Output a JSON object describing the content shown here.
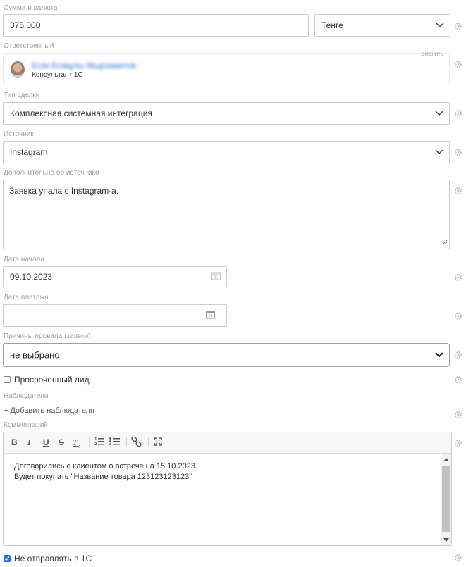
{
  "amount": {
    "label": "Сумма и валюта",
    "value": "375 000",
    "currency": "Тенге"
  },
  "responsible": {
    "label": "Ответственный",
    "name": "Есім Есімұлы Мырзаметов",
    "role": "Консультант 1С",
    "change_link": "сменить"
  },
  "deal_type": {
    "label": "Тип сделки",
    "value": "Комплексная системная интеграция"
  },
  "source": {
    "label": "Источник",
    "value": "Instagram"
  },
  "source_extra": {
    "label": "Дополнительно об источнике",
    "value": "Заявка упала с Instagram-а."
  },
  "start_date": {
    "label": "Дата начала",
    "value": "09.10.2023"
  },
  "payment_date": {
    "label": "Дата платежа",
    "value": ""
  },
  "fail_reason": {
    "label": "Причины провала (заявки)",
    "value": "не выбрано"
  },
  "overdue_lead": {
    "label": "Просроченный лид",
    "checked": false
  },
  "observers": {
    "label": "Наблюдатели",
    "add_link": "+ Добавить наблюдателя"
  },
  "comment": {
    "label": "Комментарий",
    "line1": "Договорились с клиентом о встрече на 15.10.2023.",
    "line2": "Будет покупать \"Название товара 123123123123\""
  },
  "no_send": {
    "label": "Не отправлять в 1С",
    "checked": true
  },
  "icons": {
    "gear": "gear-icon",
    "chevron": "chevron-down-icon",
    "calendar": "calendar-icon",
    "bold": "bold-icon",
    "italic": "italic-icon",
    "underline": "underline-icon",
    "strike": "strikethrough-icon",
    "clear": "clear-format-icon",
    "ol": "ordered-list-icon",
    "ul": "unordered-list-icon",
    "link": "link-icon",
    "fullscreen": "fullscreen-icon"
  },
  "colors": {
    "border": "#c8cdd2",
    "label": "#9aa1a8",
    "checkbox": "#2b6fd6"
  }
}
